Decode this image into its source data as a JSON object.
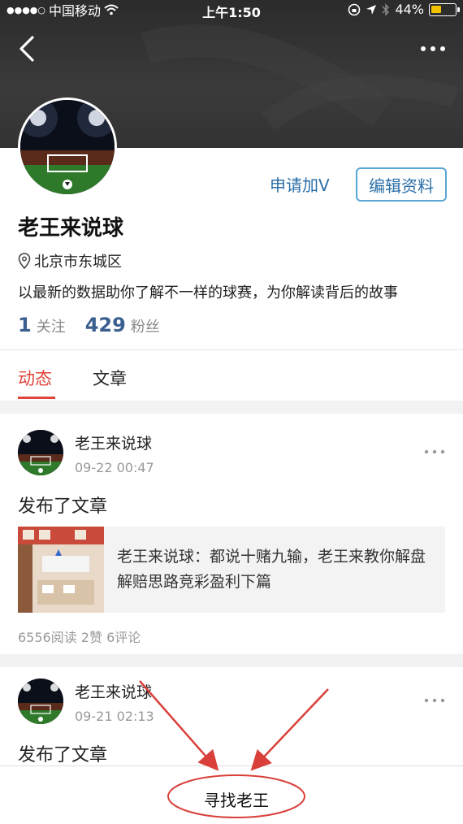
{
  "status_bar": {
    "carrier": "中国移动",
    "time": "上午1:50",
    "battery": "44%",
    "battery_level": 0.44
  },
  "profile": {
    "apply_verify": "申请加V",
    "edit_profile": "编辑资料",
    "name": "老王来说球",
    "location": "北京市东城区",
    "bio": "以最新的数据助你了解不一样的球赛，为你解读背后的故事",
    "following_count": "1",
    "following_label": "关注",
    "followers_count": "429",
    "followers_label": "粉丝"
  },
  "tabs": [
    {
      "label": "动态",
      "active": true
    },
    {
      "label": "文章",
      "active": false
    }
  ],
  "posts": [
    {
      "author": "老王来说球",
      "time": "09-22 00:47",
      "action": "发布了文章",
      "article_title": "老王来说球：都说十赌九输，老王来教你解盘解赔思路竞彩盈利下篇",
      "meta": "6556阅读 2赞 6评论"
    },
    {
      "author": "老王来说球",
      "time": "09-21 02:13",
      "action": "发布了文章"
    }
  ],
  "bottom": {
    "find_button": "寻找老王"
  },
  "colors": {
    "accent_red": "#e0443a",
    "link_blue": "#2a6ea8",
    "annotation_red": "#d9403a"
  },
  "icons": [
    "back-arrow-icon",
    "more-dots-icon",
    "wifi-icon",
    "location-arrow-icon",
    "bluetooth-icon",
    "battery-icon",
    "location-pin-icon"
  ]
}
